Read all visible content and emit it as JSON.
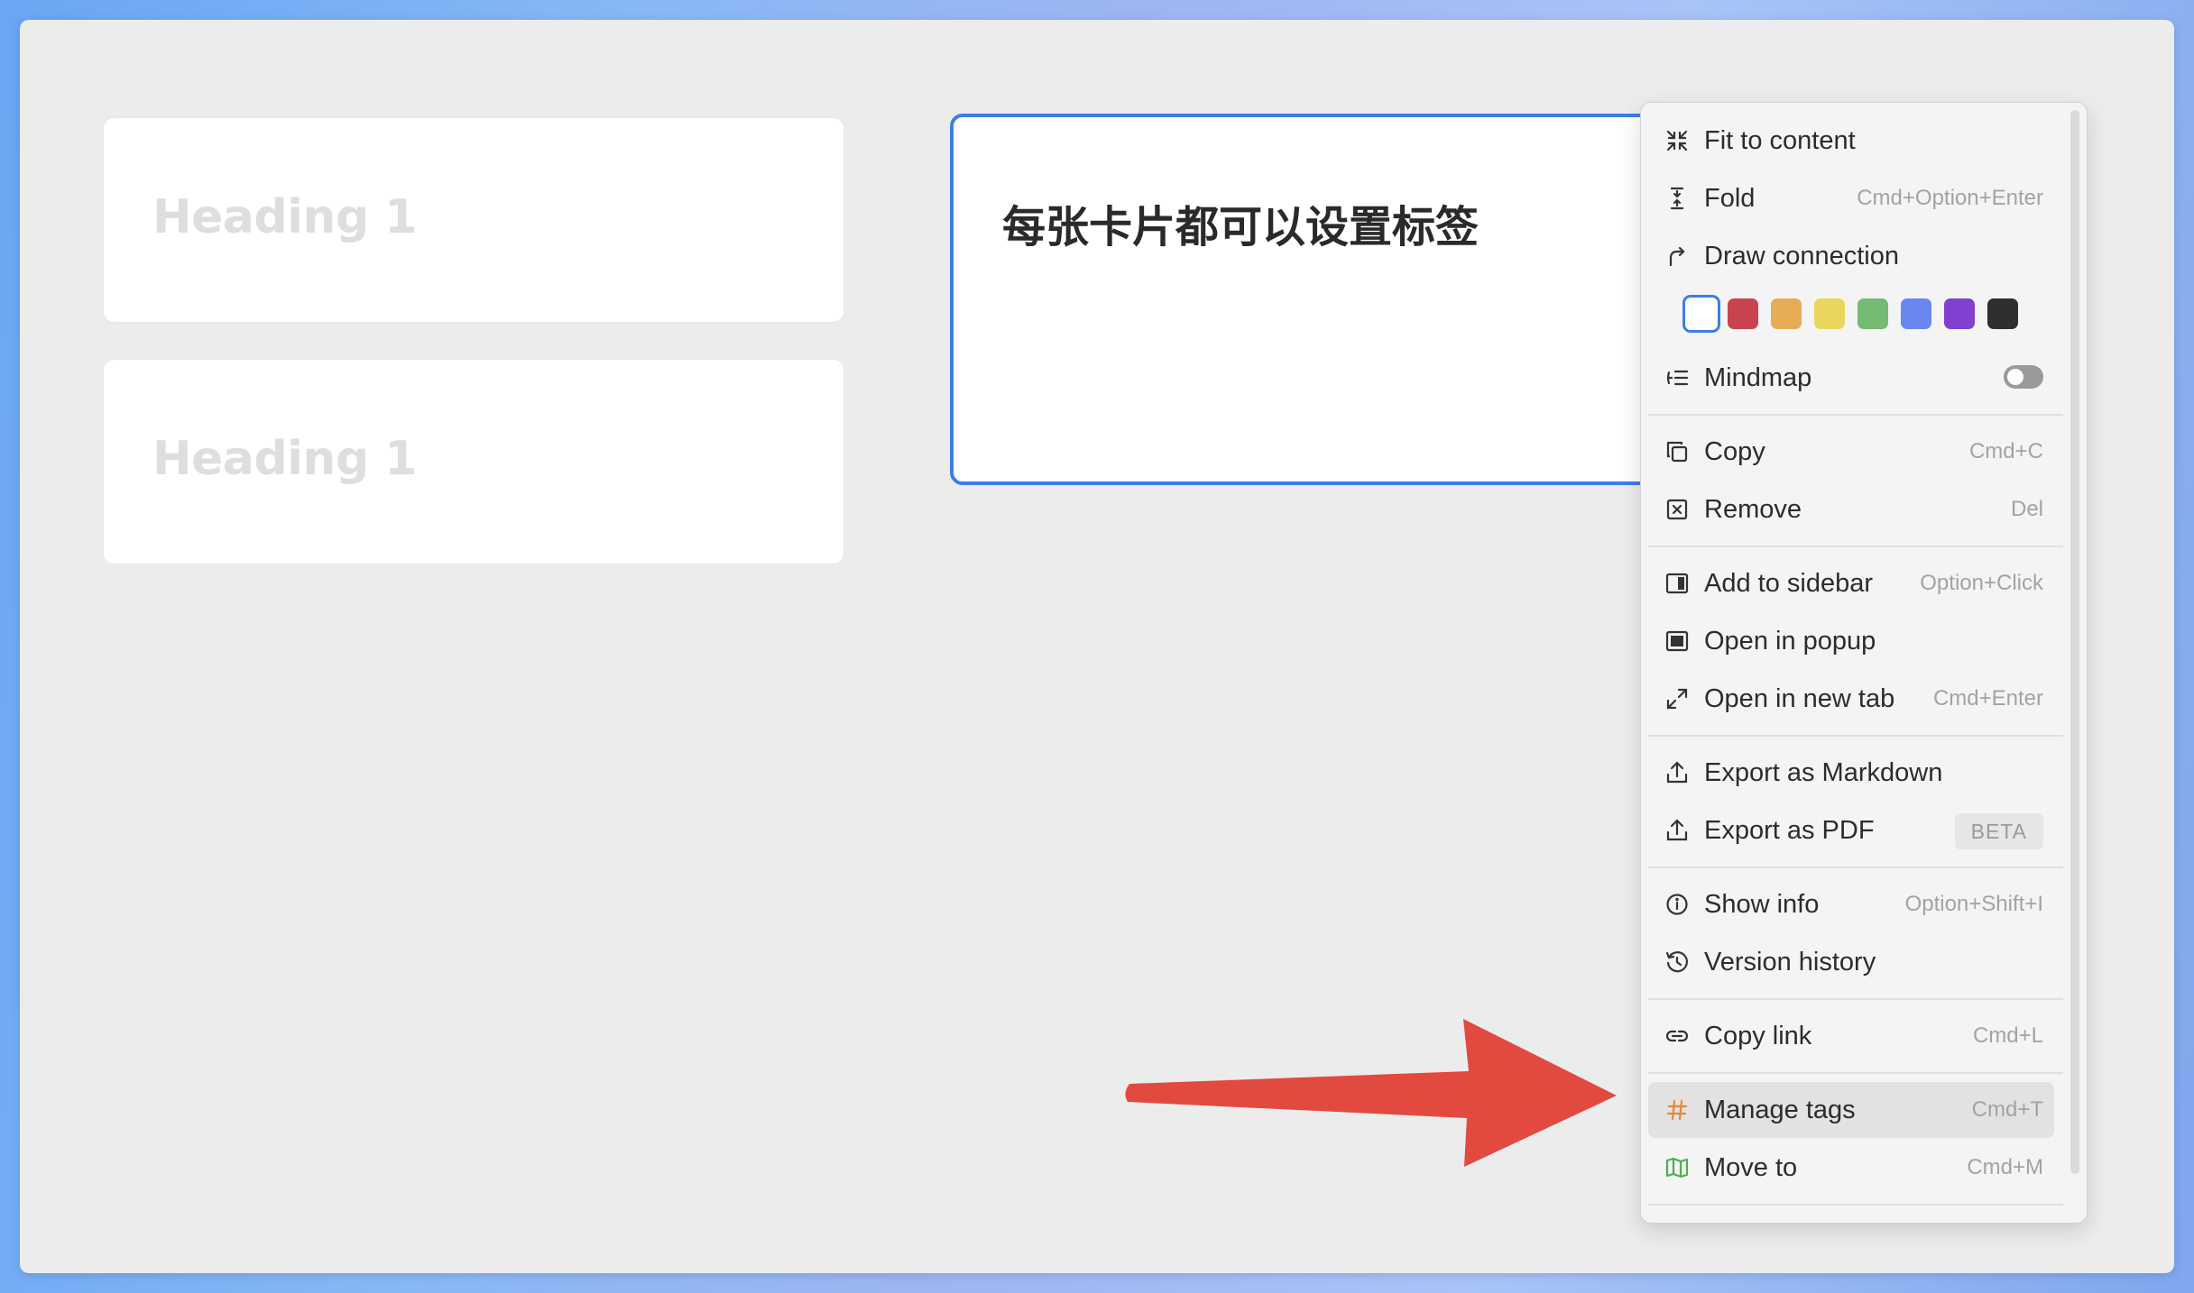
{
  "cards": [
    {
      "heading": "Heading 1"
    },
    {
      "heading": "Heading 1"
    }
  ],
  "selected_card": {
    "title": "每张卡片都可以设置标签"
  },
  "menu": {
    "items": [
      {
        "label": "Fit to content",
        "shortcut": "",
        "icon": "fit-to-content-icon"
      },
      {
        "label": "Fold",
        "shortcut": "Cmd+Option+Enter",
        "icon": "fold-icon"
      },
      {
        "label": "Draw connection",
        "shortcut": "",
        "icon": "draw-connection-icon"
      },
      {
        "label": "Mindmap",
        "shortcut": "",
        "icon": "mindmap-icon"
      },
      {
        "label": "Copy",
        "shortcut": "Cmd+C",
        "icon": "copy-icon"
      },
      {
        "label": "Remove",
        "shortcut": "Del",
        "icon": "remove-icon"
      },
      {
        "label": "Add to sidebar",
        "shortcut": "Option+Click",
        "icon": "sidebar-icon"
      },
      {
        "label": "Open in popup",
        "shortcut": "",
        "icon": "popup-icon"
      },
      {
        "label": "Open in new tab",
        "shortcut": "Cmd+Enter",
        "icon": "expand-icon"
      },
      {
        "label": "Export as Markdown",
        "shortcut": "",
        "icon": "export-icon"
      },
      {
        "label": "Export as PDF",
        "badge": "BETA",
        "icon": "export-icon"
      },
      {
        "label": "Show info",
        "shortcut": "Option+Shift+I",
        "icon": "info-icon"
      },
      {
        "label": "Version history",
        "shortcut": "",
        "icon": "history-icon"
      },
      {
        "label": "Copy link",
        "shortcut": "Cmd+L",
        "icon": "link-icon"
      },
      {
        "label": "Manage tags",
        "shortcut": "Cmd+T",
        "icon": "hash-icon"
      },
      {
        "label": "Move to",
        "shortcut": "Cmd+M",
        "icon": "map-icon"
      }
    ],
    "colors": [
      "#ffffff",
      "#c9434f",
      "#e7ac55",
      "#ead65e",
      "#74ba72",
      "#6987f0",
      "#8140d0",
      "#2f2f2f"
    ],
    "selected_color_index": 0,
    "mindmap_enabled": false,
    "hover_item": "Manage tags"
  },
  "accent_color": "#3c7ee6",
  "arrow_color": "#e2493f"
}
